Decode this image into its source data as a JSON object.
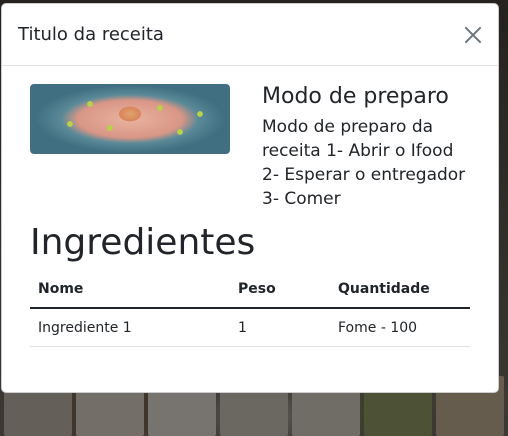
{
  "modal": {
    "title": "Titulo da receita",
    "close_icon": "close-icon"
  },
  "preparation": {
    "heading": "Modo de preparo",
    "text": "Modo de preparo da receita 1- Abrir o Ifood 2- Esperar o entregador 3- Comer"
  },
  "ingredients": {
    "heading": "Ingredientes",
    "columns": [
      "Nome",
      "Peso",
      "Quantidade"
    ],
    "rows": [
      [
        "Ingrediente 1",
        "1",
        "Fome - 100"
      ]
    ]
  }
}
